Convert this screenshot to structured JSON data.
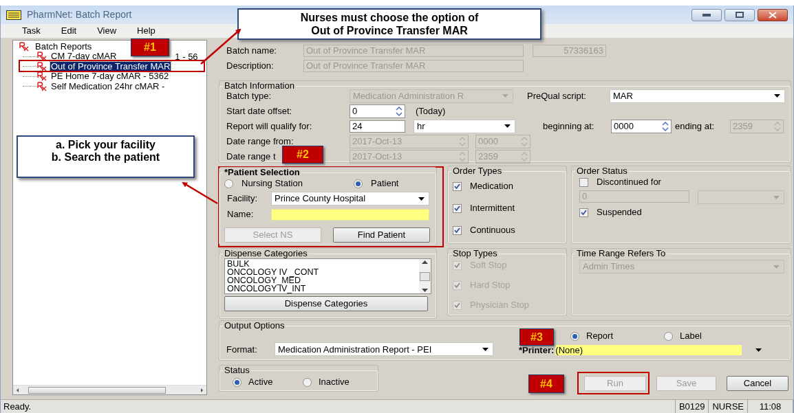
{
  "window": {
    "title": "PharmNet: Batch Report"
  },
  "menu": [
    "Task",
    "Edit",
    "View",
    "Help"
  ],
  "tree": {
    "label": "Batch Reports",
    "expanded": true,
    "children": [
      {
        "label": "CM 7-day cMAR",
        "label_tail": "1 - 56",
        "selected": false
      },
      {
        "label": "Out of Province Transfer MAR",
        "selected": true
      },
      {
        "label": "PE Home 7-day cMAR - 5362",
        "selected": false
      },
      {
        "label": "Self Medication 24hr cMAR -",
        "selected": false
      }
    ]
  },
  "batch": {
    "name_label": "Batch name:",
    "name": {
      "value": "Out of Province Transfer MAR",
      "disabled": true
    },
    "id": {
      "value": "57336163",
      "disabled": true
    },
    "description_label": "Description:",
    "description": {
      "value": "Out of Province Transfer MAR",
      "disabled": true
    }
  },
  "batch_information": {
    "title": "Batch Information",
    "batch_type": {
      "label": "Batch type:",
      "value": "Medication Administration R",
      "disabled": true
    },
    "prequal": {
      "label": "PreQual script:",
      "value": "MAR",
      "disabled": false
    },
    "start_offset": {
      "label": "Start date offset:",
      "value": "0",
      "disabled": false,
      "note": "(Today)"
    },
    "qualify": {
      "label": "Report will qualify for:",
      "value": "24",
      "disabled": false,
      "unit": {
        "value": "hr",
        "disabled": false
      }
    },
    "beginning": {
      "label": "beginning at:",
      "value": "0000",
      "disabled": false
    },
    "ending": {
      "label": "ending at:",
      "value": "2359",
      "disabled": true
    },
    "range_from": {
      "label": "Date range from:",
      "date": {
        "value": "2017-Oct-13",
        "disabled": true
      },
      "time": {
        "value": "0000",
        "disabled": true
      }
    },
    "range_to": {
      "label": "Date range t",
      "date": {
        "value": "2017-Oct-13",
        "disabled": true
      },
      "time": {
        "value": "2359",
        "disabled": true
      }
    }
  },
  "patient_selection": {
    "title": "*Patient Selection",
    "radios": [
      {
        "label": "Nursing Station",
        "selected": false
      },
      {
        "label": "Patient",
        "selected": true
      }
    ],
    "facility": {
      "label": "Facility:",
      "value": "Prince County Hospital",
      "disabled": false
    },
    "name": {
      "label": "Name:",
      "required": true
    },
    "buttons": [
      {
        "label": "Select NS",
        "disabled": true
      },
      {
        "label": "Find Patient",
        "disabled": false
      }
    ]
  },
  "order_types": {
    "title": "Order Types",
    "items": [
      {
        "label": "Medication",
        "checked": true,
        "disabled": false
      },
      {
        "label": "Intermittent",
        "checked": true,
        "disabled": false
      },
      {
        "label": "Continuous",
        "checked": true,
        "disabled": false
      }
    ]
  },
  "order_status": {
    "title": "Order Status",
    "discontinued": {
      "label": "Discontinued for",
      "checked": false,
      "disabled": false
    },
    "days": {
      "value": "0",
      "disabled": true
    },
    "unit": {
      "disabled": true
    },
    "suspended": {
      "label": "Suspended",
      "checked": true,
      "disabled": false
    }
  },
  "dispense_categories": {
    "title": "Dispense Categories",
    "items": [
      "BULK",
      "ONCOLOGY IV _CONT",
      "ONCOLOGY_MED",
      "ONCOLOGY IV_INT"
    ],
    "button": "Dispense Categories"
  },
  "stop_types": {
    "title": "Stop Types",
    "items": [
      {
        "label": "Soft Stop",
        "checked": true,
        "disabled": true
      },
      {
        "label": "Hard Stop",
        "checked": true,
        "disabled": true
      },
      {
        "label": "Physician Stop",
        "checked": true,
        "disabled": true
      }
    ]
  },
  "time_range": {
    "title": "Time Range Refers To",
    "value": "Admin Times",
    "disabled": true
  },
  "output_options": {
    "title": "Output Options",
    "format_label": "Format:",
    "format": {
      "value": "Medication Administration Report - PEI",
      "disabled": false
    },
    "radios": [
      {
        "label": "Report",
        "selected": true
      },
      {
        "label": "Label",
        "selected": false
      }
    ],
    "printer_label": "*Printer:",
    "printer": {
      "value": "(None)",
      "required": true
    }
  },
  "status": {
    "title": "Status",
    "radios": [
      {
        "label": "Active",
        "selected": true
      },
      {
        "label": "Inactive",
        "selected": false
      }
    ]
  },
  "buttons": [
    {
      "label": "Run",
      "disabled": true
    },
    {
      "label": "Save",
      "disabled": true
    },
    {
      "label": "Cancel",
      "disabled": false
    }
  ],
  "status_bar": {
    "message": "Ready.",
    "panes": [
      "B0129",
      "NURSE",
      "11:08"
    ]
  },
  "annotations": {
    "callouts": [
      "Nurses must choose the option of\nOut of Province Transfer MAR",
      "a. Pick your facility\nb. Search the patient"
    ],
    "badges": [
      "#1",
      "#2",
      "#3",
      "#4"
    ]
  }
}
